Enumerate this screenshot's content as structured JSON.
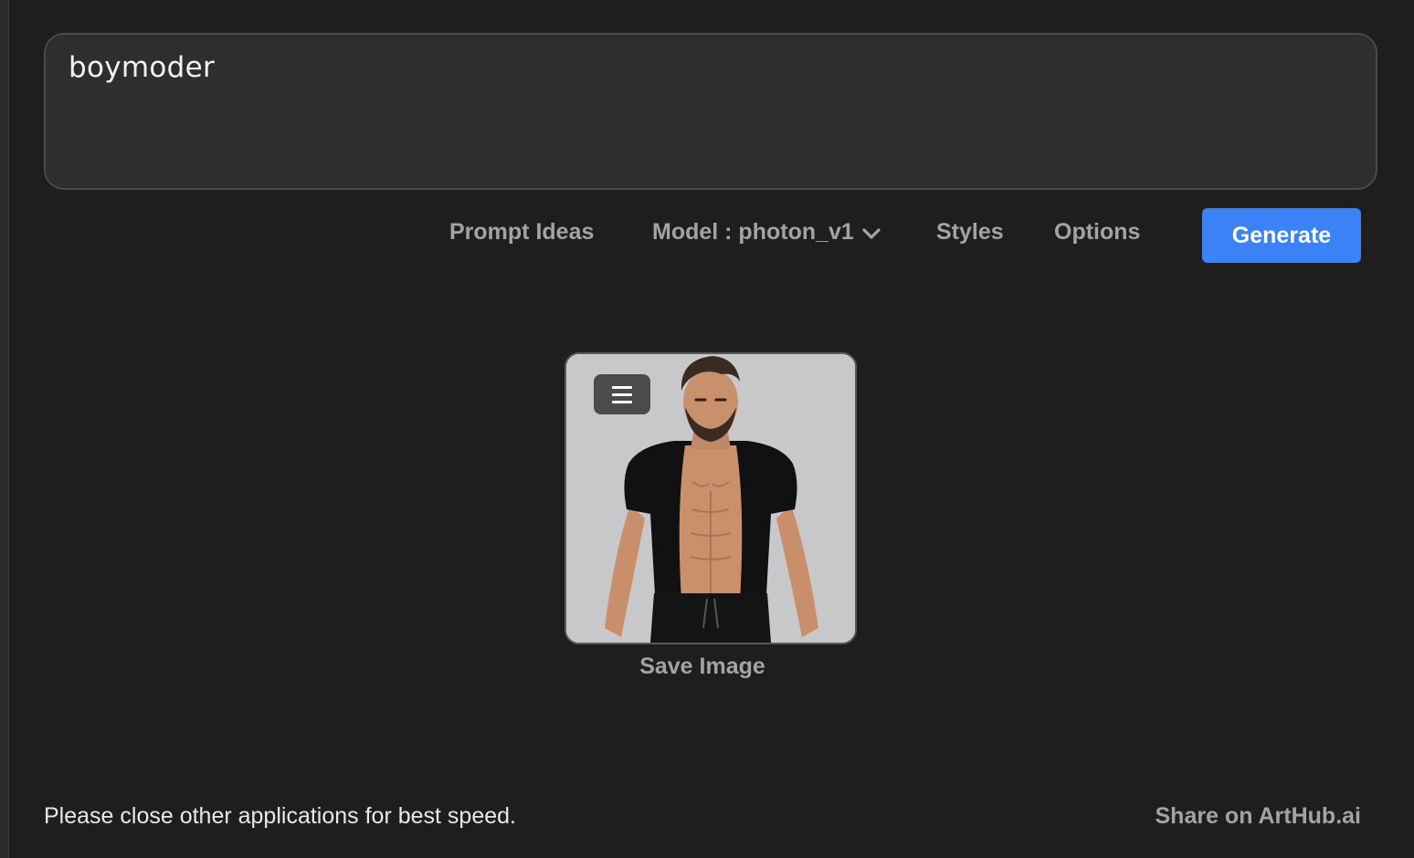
{
  "prompt": {
    "value": "boymoder"
  },
  "toolbar": {
    "prompt_ideas_label": "Prompt Ideas",
    "model_label": "Model : photon_v1",
    "styles_label": "Styles",
    "options_label": "Options",
    "generate_label": "Generate"
  },
  "result": {
    "save_label": "Save Image",
    "menu_icon": "hamburger-menu-icon",
    "image_subject": "generated-portrait"
  },
  "footer": {
    "note": "Please close other applications for best speed.",
    "share_label": "Share on ArtHub.ai"
  },
  "colors": {
    "background": "#1e1e1f",
    "prompt_bg": "#2e2d2f",
    "accent": "#3b82f6",
    "muted_text": "#a3a3a6"
  }
}
